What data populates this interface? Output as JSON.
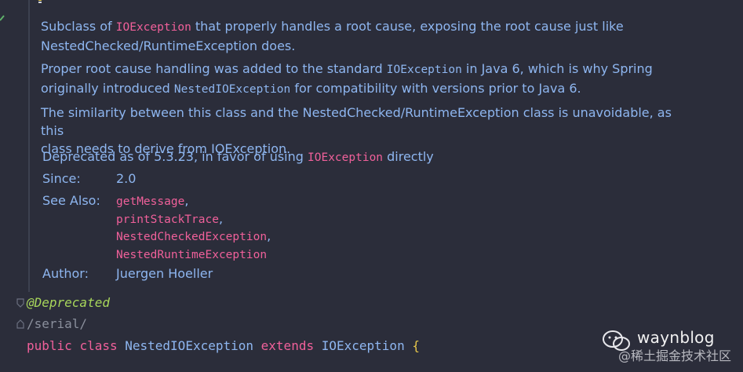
{
  "doc": {
    "p1_a": "Subclass of ",
    "p1_code": "IOException",
    "p1_b": " that properly handles a root cause, exposing the root cause just like",
    "p1_c": "NestedChecked/RuntimeException does.",
    "p2_a": "Proper root cause handling was added to the standard ",
    "p2_code1": "IOException",
    "p2_b": " in Java 6, which is why Spring",
    "p2_c": "originally introduced ",
    "p2_code2": "NestedIOException",
    "p2_d": " for compatibility with versions prior to Java 6.",
    "p3_a": "The similarity between this class and the NestedChecked/RuntimeException class is unavoidable, as this",
    "p3_b": "class needs to derive from IOException."
  },
  "tags": {
    "deprecated_label": "Deprecated",
    "deprecated_a": " as of 5.3.23, in favor of using ",
    "deprecated_code": "IOException",
    "deprecated_b": " directly",
    "since_label": "Since:",
    "since_value": "2.0",
    "see_label": "See Also:",
    "see_items": [
      "getMessage",
      "printStackTrace",
      "NestedCheckedException",
      "NestedRuntimeException"
    ],
    "author_label": "Author:",
    "author_value": "Juergen Hoeller"
  },
  "code": {
    "annotation": "@Deprecated",
    "serial": "/serial/",
    "kw_public": "public",
    "kw_class": "class",
    "class_name": "NestedIOException",
    "kw_extends": "extends",
    "super_name": "IOException",
    "brace": "{"
  },
  "watermark": {
    "name": "waynblog",
    "sub": "@稀土掘金技术社区"
  },
  "colors": {
    "background": "#2b2d3a",
    "doc_text": "#8eb6f0",
    "code_ref": "#f0609a",
    "annotation": "#a8d65b",
    "brace": "#e6c64a"
  }
}
